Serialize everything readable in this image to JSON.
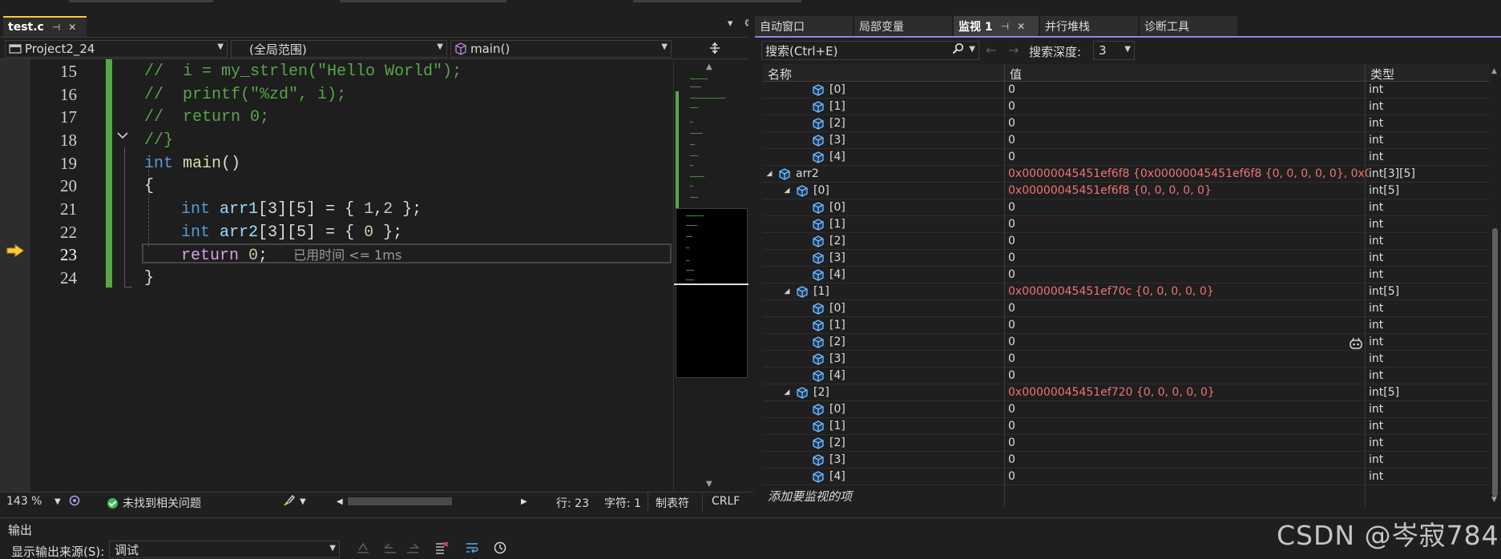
{
  "editor": {
    "tab": {
      "label": "test.c",
      "pin": "⊣",
      "close": "✕"
    },
    "tabrow_overflow": "▾",
    "tabrow_settings": "⚙",
    "nav": {
      "project": "Project2_24",
      "scope": "(全局范围)",
      "function": "main()"
    },
    "lines": [
      {
        "num": "15",
        "text": "//  i = my_strlen(\"Hello World\");"
      },
      {
        "num": "16",
        "text": "//  printf(\"%zd\", i);"
      },
      {
        "num": "17",
        "text": "//  return 0;"
      },
      {
        "num": "18",
        "text": "//}"
      },
      {
        "num": "19",
        "kw": "int",
        "fn": "main",
        "rest": "()"
      },
      {
        "num": "20",
        "text": "{"
      },
      {
        "num": "21",
        "kw": "int",
        "id": "arr1",
        "dims": "[3][5]",
        "eq": " = { ",
        "n1": "1",
        "comma": ",",
        "n2": "2",
        "end": " };"
      },
      {
        "num": "22",
        "kw": "int",
        "id": "arr2",
        "dims": "[3][5]",
        "eq": " = { ",
        "n1": "0",
        "end": " };"
      },
      {
        "num": "23",
        "kw": "return",
        "n1": "0",
        "end": ";",
        "hint": "已用时间 <= 1ms"
      },
      {
        "num": "24",
        "text": "}"
      }
    ],
    "status": {
      "zoom": "143 %",
      "issues": "未找到相关问题",
      "line": "行: 23",
      "char": "字符: 1",
      "tabs": "制表符",
      "eol": "CRLF"
    }
  },
  "watch": {
    "tabs": [
      "自动窗口",
      "局部变量",
      "监视 1",
      "并行堆栈",
      "诊断工具"
    ],
    "search_placeholder": "搜索(Ctrl+E)",
    "depth_label": "搜索深度:",
    "depth_value": "3",
    "columns": [
      "名称",
      "值",
      "类型"
    ],
    "rows": [
      {
        "level": 3,
        "name": "[0]",
        "value": "0",
        "type": "int"
      },
      {
        "level": 3,
        "name": "[1]",
        "value": "0",
        "type": "int"
      },
      {
        "level": 3,
        "name": "[2]",
        "value": "0",
        "type": "int"
      },
      {
        "level": 3,
        "name": "[3]",
        "value": "0",
        "type": "int"
      },
      {
        "level": 3,
        "name": "[4]",
        "value": "0",
        "type": "int"
      },
      {
        "level": 1,
        "name": "arr2",
        "value": "0x00000045451ef6f8 {0x00000045451ef6f8 {0, 0, 0, 0, 0}, 0x000000...",
        "type": "int[3][5]",
        "expanded": true,
        "changed": true
      },
      {
        "level": 2,
        "name": "[0]",
        "value": "0x00000045451ef6f8 {0, 0, 0, 0, 0}",
        "type": "int[5]",
        "expanded": true,
        "changed": true
      },
      {
        "level": 3,
        "name": "[0]",
        "value": "0",
        "type": "int"
      },
      {
        "level": 3,
        "name": "[1]",
        "value": "0",
        "type": "int"
      },
      {
        "level": 3,
        "name": "[2]",
        "value": "0",
        "type": "int"
      },
      {
        "level": 3,
        "name": "[3]",
        "value": "0",
        "type": "int"
      },
      {
        "level": 3,
        "name": "[4]",
        "value": "0",
        "type": "int"
      },
      {
        "level": 2,
        "name": "[1]",
        "value": "0x00000045451ef70c {0, 0, 0, 0, 0}",
        "type": "int[5]",
        "expanded": true,
        "changed": true
      },
      {
        "level": 3,
        "name": "[0]",
        "value": "0",
        "type": "int"
      },
      {
        "level": 3,
        "name": "[1]",
        "value": "0",
        "type": "int"
      },
      {
        "level": 3,
        "name": "[2]",
        "value": "0",
        "type": "int"
      },
      {
        "level": 3,
        "name": "[3]",
        "value": "0",
        "type": "int"
      },
      {
        "level": 3,
        "name": "[4]",
        "value": "0",
        "type": "int"
      },
      {
        "level": 2,
        "name": "[2]",
        "value": "0x00000045451ef720 {0, 0, 0, 0, 0}",
        "type": "int[5]",
        "expanded": true,
        "changed": true
      },
      {
        "level": 3,
        "name": "[0]",
        "value": "0",
        "type": "int"
      },
      {
        "level": 3,
        "name": "[1]",
        "value": "0",
        "type": "int"
      },
      {
        "level": 3,
        "name": "[2]",
        "value": "0",
        "type": "int"
      },
      {
        "level": 3,
        "name": "[3]",
        "value": "0",
        "type": "int"
      },
      {
        "level": 3,
        "name": "[4]",
        "value": "0",
        "type": "int"
      }
    ],
    "add_watch": "添加要监视的项"
  },
  "output": {
    "title": "输出",
    "source_label": "显示输出来源(S):",
    "source_value": "调试"
  },
  "watermark": "CSDN @岑寂784",
  "colors": {
    "accent": "#9184ee",
    "tab_active_top": "#ffc83d",
    "changed_value": "#f07272",
    "comment": "#57a64a",
    "keyword": "#569cd6"
  }
}
